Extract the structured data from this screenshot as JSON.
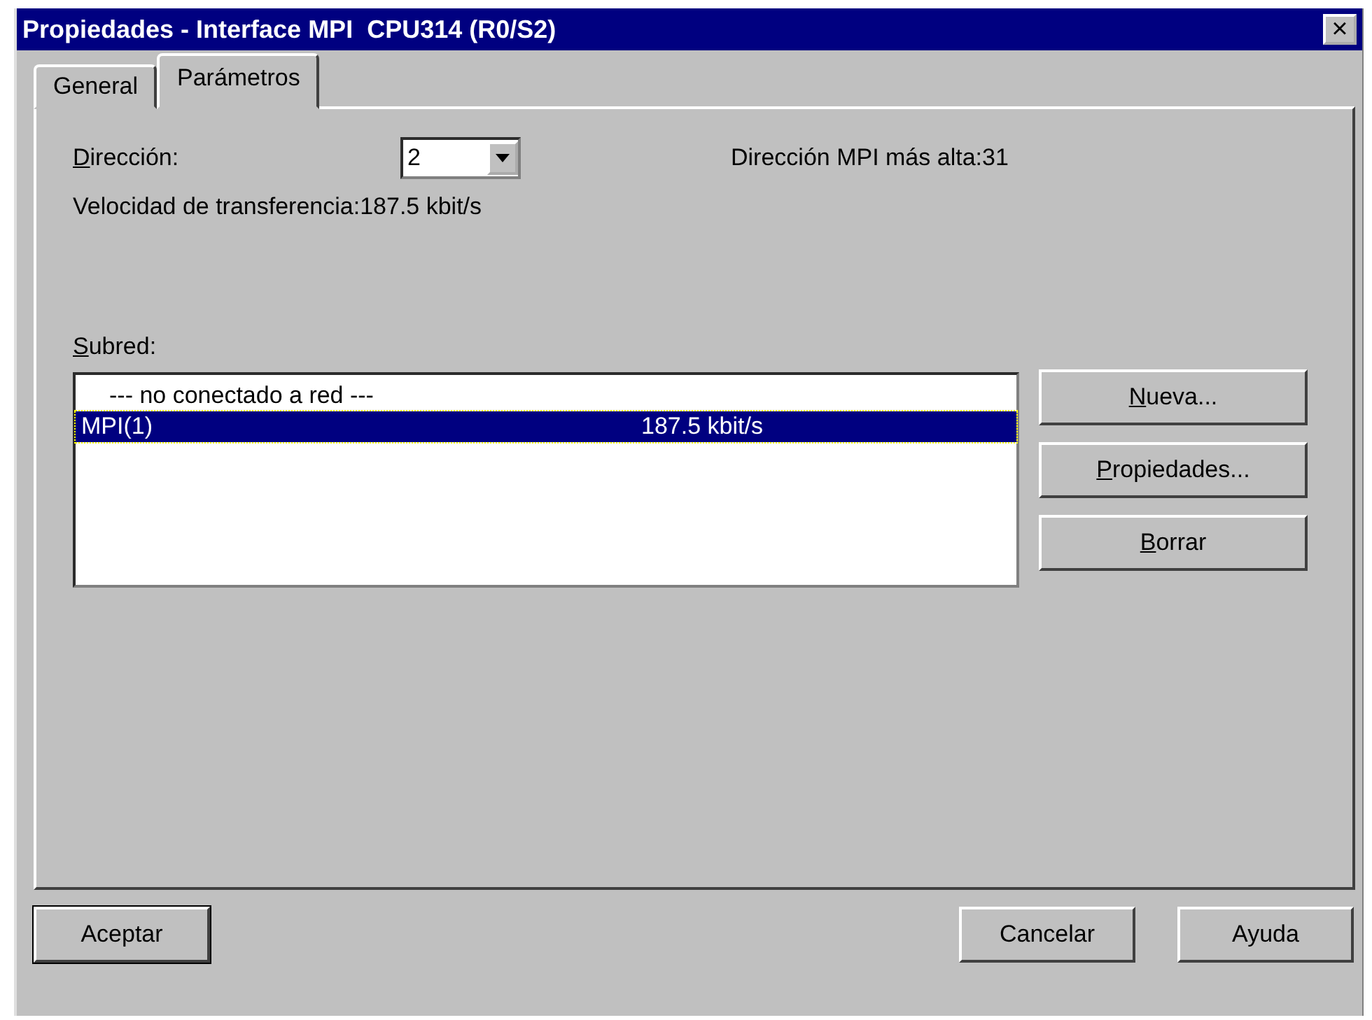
{
  "window": {
    "title": "Propiedades - Interface MPI  CPU314 (R0/S2)",
    "close": "×"
  },
  "tabs": [
    {
      "label": "General",
      "selected": false
    },
    {
      "label": "Parámetros",
      "selected": true
    }
  ],
  "address": {
    "label": "Dirección:",
    "value": "2",
    "highest": "Dirección MPI más alta:31"
  },
  "transfer_rate": "Velocidad de transferencia:187.5 kbit/s",
  "subnet": {
    "label": "Subred:",
    "rows": [
      {
        "name": "--- no conectado a red ---",
        "rate": "",
        "selected": false
      },
      {
        "name": "MPI(1)",
        "rate": "187.5 kbit/s",
        "selected": true
      }
    ],
    "buttons": [
      "Nueva...",
      "Propiedades...",
      "Borrar"
    ]
  },
  "footer_buttons": [
    {
      "label": "Aceptar",
      "default": true
    },
    {
      "label": "Cancelar",
      "default": false
    },
    {
      "label": "Ayuda",
      "default": false
    }
  ]
}
